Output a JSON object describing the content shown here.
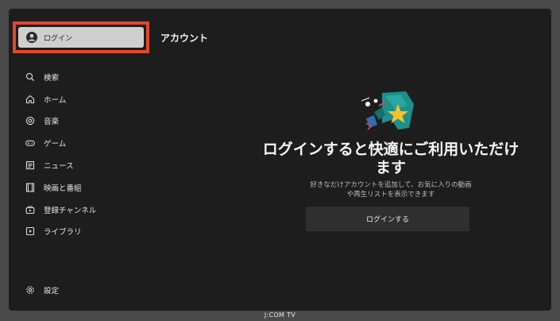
{
  "login": {
    "label": "ログイン"
  },
  "page_title": "アカウント",
  "nav": [
    {
      "icon": "search-icon",
      "label": "検索"
    },
    {
      "icon": "home-icon",
      "label": "ホーム"
    },
    {
      "icon": "music-icon",
      "label": "音楽"
    },
    {
      "icon": "gamepad-icon",
      "label": "ゲーム"
    },
    {
      "icon": "news-icon",
      "label": "ニュース"
    },
    {
      "icon": "film-icon",
      "label": "映画と番組"
    },
    {
      "icon": "subscriptions-icon",
      "label": "登録チャンネル"
    },
    {
      "icon": "library-icon",
      "label": "ライブラリ"
    }
  ],
  "settings": {
    "icon": "gear-icon",
    "label": "設定"
  },
  "main": {
    "headline_line1": "ログインすると快適にご利用いただけ",
    "headline_line2": "ます",
    "desc_line1": "好きなだけアカウントを追加して、お気に入りの動画",
    "desc_line2": "や再生リストを表示できます",
    "cta_label": "ログインする"
  },
  "bezel": {
    "label": "J:COM TV"
  },
  "colors": {
    "focus_border": "#e3472b",
    "background": "#1d1d1d",
    "bezel": "#4a4a4a",
    "art_teal": "#1f8f8a",
    "art_star": "#f2c230"
  }
}
